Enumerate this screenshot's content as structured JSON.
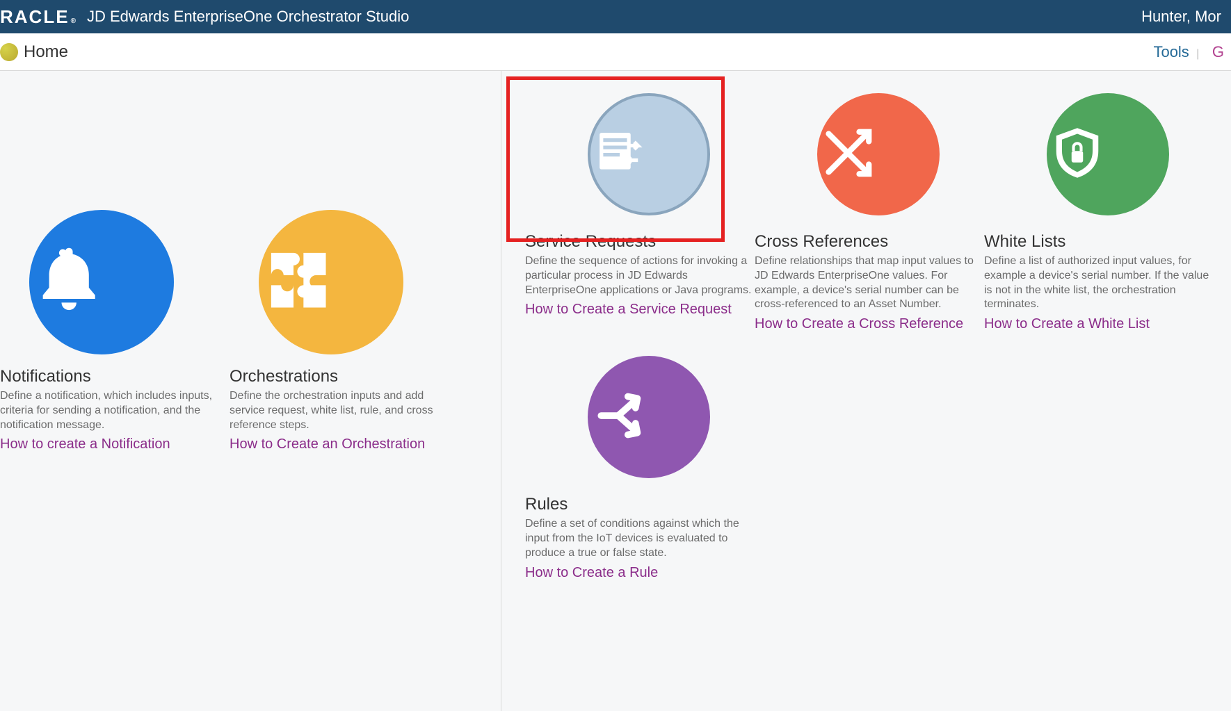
{
  "header": {
    "brand": "RACLE",
    "reg": "®",
    "product": "JD Edwards EnterpriseOne Orchestrator Studio",
    "user": "Hunter, Mor"
  },
  "subheader": {
    "title": "Home",
    "links": {
      "tools": "Tools",
      "second": "G"
    }
  },
  "tiles": {
    "notifications": {
      "title": "Notifications",
      "desc": "Define a notification, which includes inputs, criteria for sending a notification, and the notification message.",
      "link": "How to create a Notification"
    },
    "orchestrations": {
      "title": "Orchestrations",
      "desc": "Define the orchestration inputs and add service request, white list, rule, and cross reference steps.",
      "link": "How to Create an Orchestration"
    },
    "service_requests": {
      "title": "Service Requests",
      "desc": "Define the sequence of actions for invoking a particular process in JD Edwards EnterpriseOne applications or Java programs.",
      "link": "How to Create a Service Request"
    },
    "cross_references": {
      "title": "Cross References",
      "desc": "Define relationships that map input values to JD Edwards EnterpriseOne values. For example, a device's serial number can be cross-referenced to an Asset Number.",
      "link": "How to Create a Cross Reference"
    },
    "white_lists": {
      "title": "White Lists",
      "desc": "Define a list of authorized input values, for example a device's serial number. If the value is not in the white list, the orchestration terminates.",
      "link": "How to Create a White List"
    },
    "rules": {
      "title": "Rules",
      "desc": "Define a set of conditions against which the input from the IoT devices is evaluated to produce a true or false state.",
      "link": "How to Create a Rule"
    }
  }
}
